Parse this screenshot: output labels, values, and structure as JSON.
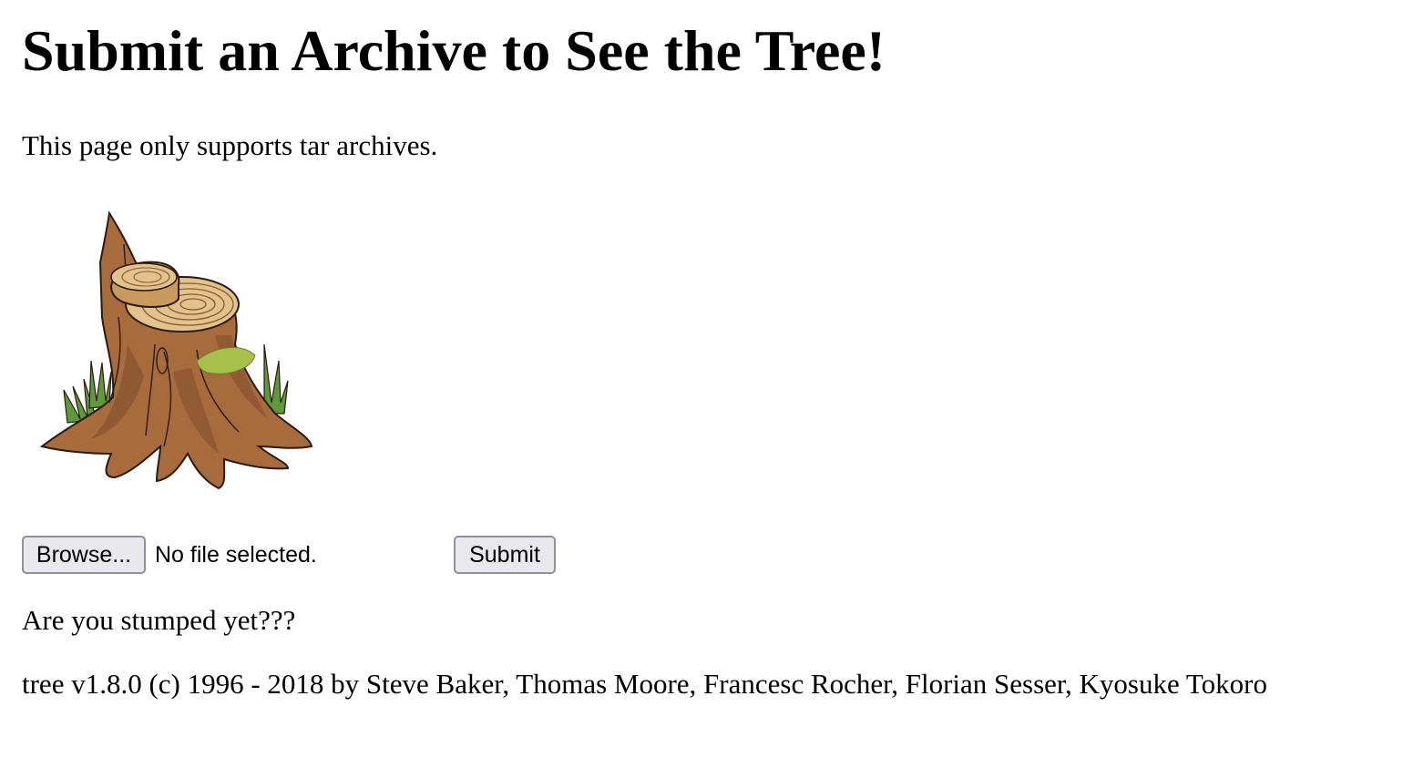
{
  "page": {
    "title": "Submit an Archive to See the Tree!",
    "intro": "This page only supports tar archives.",
    "image": {
      "icon": "tree-stump-illustration",
      "colors": {
        "bark": "#a86b3c",
        "bark_dark": "#7a4a28",
        "rings": "#e2c38e",
        "moss": "#a7c04a",
        "grass": "#5f9a3a",
        "outline": "#2a1a10"
      }
    }
  },
  "form": {
    "browse_label": "Browse...",
    "file_status": "No file selected.",
    "submit_label": "Submit"
  },
  "message": "Are you stumped yet???",
  "footer": "tree v1.8.0 (c) 1996 - 2018 by Steve Baker, Thomas Moore, Francesc Rocher, Florian Sesser, Kyosuke Tokoro"
}
